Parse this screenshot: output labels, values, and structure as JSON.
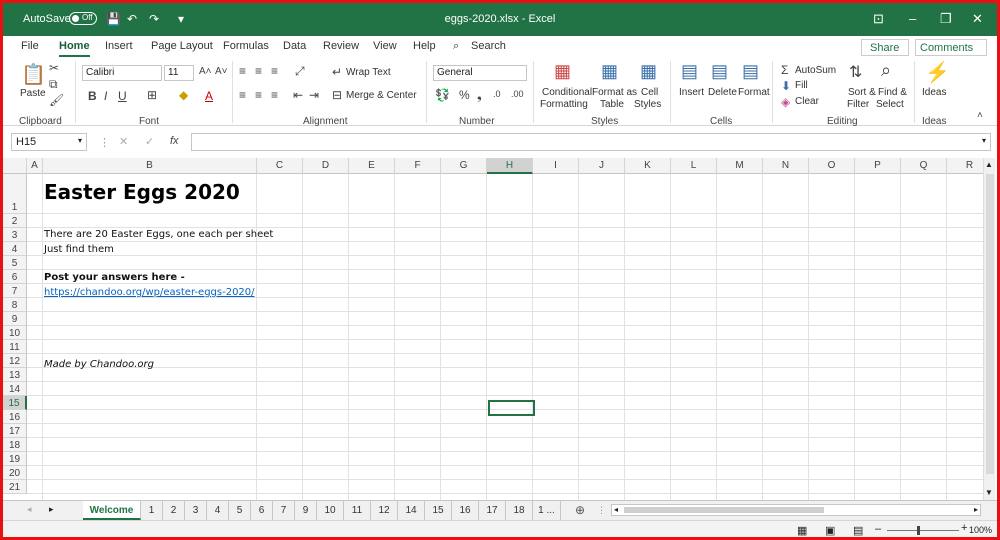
{
  "titlebar": {
    "autosave_label": "AutoSave",
    "autosave_state": "Off",
    "filename": "eggs-2020.xlsx",
    "app_sep": "-",
    "app": "Excel"
  },
  "tabs": [
    "File",
    "Home",
    "Insert",
    "Page Layout",
    "Formulas",
    "Data",
    "Review",
    "View",
    "Help"
  ],
  "search_label": "Search",
  "share_label": "Share",
  "comments_label": "Comments",
  "ribbon": {
    "paste": "Paste",
    "font_name": "Calibri",
    "font_size": "11",
    "wrap_text": "Wrap Text",
    "merge_center": "Merge & Center",
    "number_format": "General",
    "cond_format_1": "Conditional",
    "cond_format_2": "Formatting",
    "format_as_1": "Format as",
    "format_as_2": "Table",
    "cell_styles_1": "Cell",
    "cell_styles_2": "Styles",
    "insert": "Insert",
    "delete": "Delete",
    "format": "Format",
    "autosum": "AutoSum",
    "fill": "Fill",
    "clear": "Clear",
    "sort_1": "Sort &",
    "sort_2": "Filter",
    "find_1": "Find &",
    "find_2": "Select",
    "ideas": "Ideas",
    "groups": [
      "Clipboard",
      "Font",
      "Alignment",
      "Number",
      "Styles",
      "Cells",
      "Editing",
      "Ideas"
    ]
  },
  "namebox": "H15",
  "fx": "fx",
  "columns": [
    "A",
    "B",
    "C",
    "D",
    "E",
    "F",
    "G",
    "H",
    "I",
    "J",
    "K",
    "L",
    "M",
    "N",
    "O",
    "P",
    "Q",
    "R"
  ],
  "rows": [
    "1",
    "2",
    "3",
    "4",
    "5",
    "6",
    "7",
    "8",
    "9",
    "10",
    "11",
    "12",
    "13",
    "14",
    "15",
    "16",
    "17",
    "18",
    "19",
    "20",
    "21"
  ],
  "cells": {
    "b1": "Easter Eggs 2020",
    "b3": "There are 20 Easter Eggs, one each per sheet",
    "b4": "Just find them",
    "b6": "Post your answers here -",
    "b7": "https://chandoo.org/wp/easter-eggs-2020/",
    "b12": "Made by Chandoo.org"
  },
  "sheets": [
    "Welcome",
    "1",
    "2",
    "3",
    "4",
    "5",
    "6",
    "7",
    "9",
    "10",
    "11",
    "12",
    "14",
    "15",
    "16",
    "17",
    "18",
    "1 ..."
  ],
  "zoom": "100%"
}
